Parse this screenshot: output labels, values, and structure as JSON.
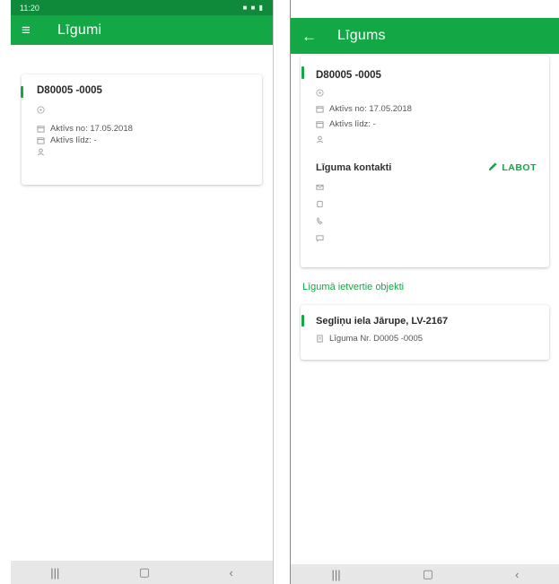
{
  "left": {
    "status": {
      "time": "11:20",
      "icons": "■ ■ ▮"
    },
    "appbar": {
      "menu_icon": "≡",
      "title": "Līgumi"
    },
    "contract": {
      "number": "D80005 -0005",
      "active_from": "Aktīvs no: 17.05.2018",
      "active_until": "Aktīvs līdz: -"
    },
    "navbar": {
      "recent": "|||",
      "home": "▢",
      "back": "‹"
    }
  },
  "right": {
    "appbar": {
      "back_icon": "←",
      "title": "Līgums"
    },
    "contract": {
      "number": "D80005 -0005",
      "active_from": "Aktīvs no: 17.05.2018",
      "active_until": "Aktīvs līdz: -"
    },
    "contacts": {
      "title": "Līguma kontakti",
      "edit_label": "LABOT"
    },
    "objects_section_title": "Līgumā ietvertie objekti",
    "object": {
      "address": "Segliņu iela Jārupe, LV-2167",
      "contract_ref": "Līguma Nr. D0005 -0005"
    },
    "navbar": {
      "recent": "|||",
      "home": "▢",
      "back": "‹"
    }
  },
  "colors": {
    "primary": "#13a845",
    "status": "#0e8a3a"
  }
}
